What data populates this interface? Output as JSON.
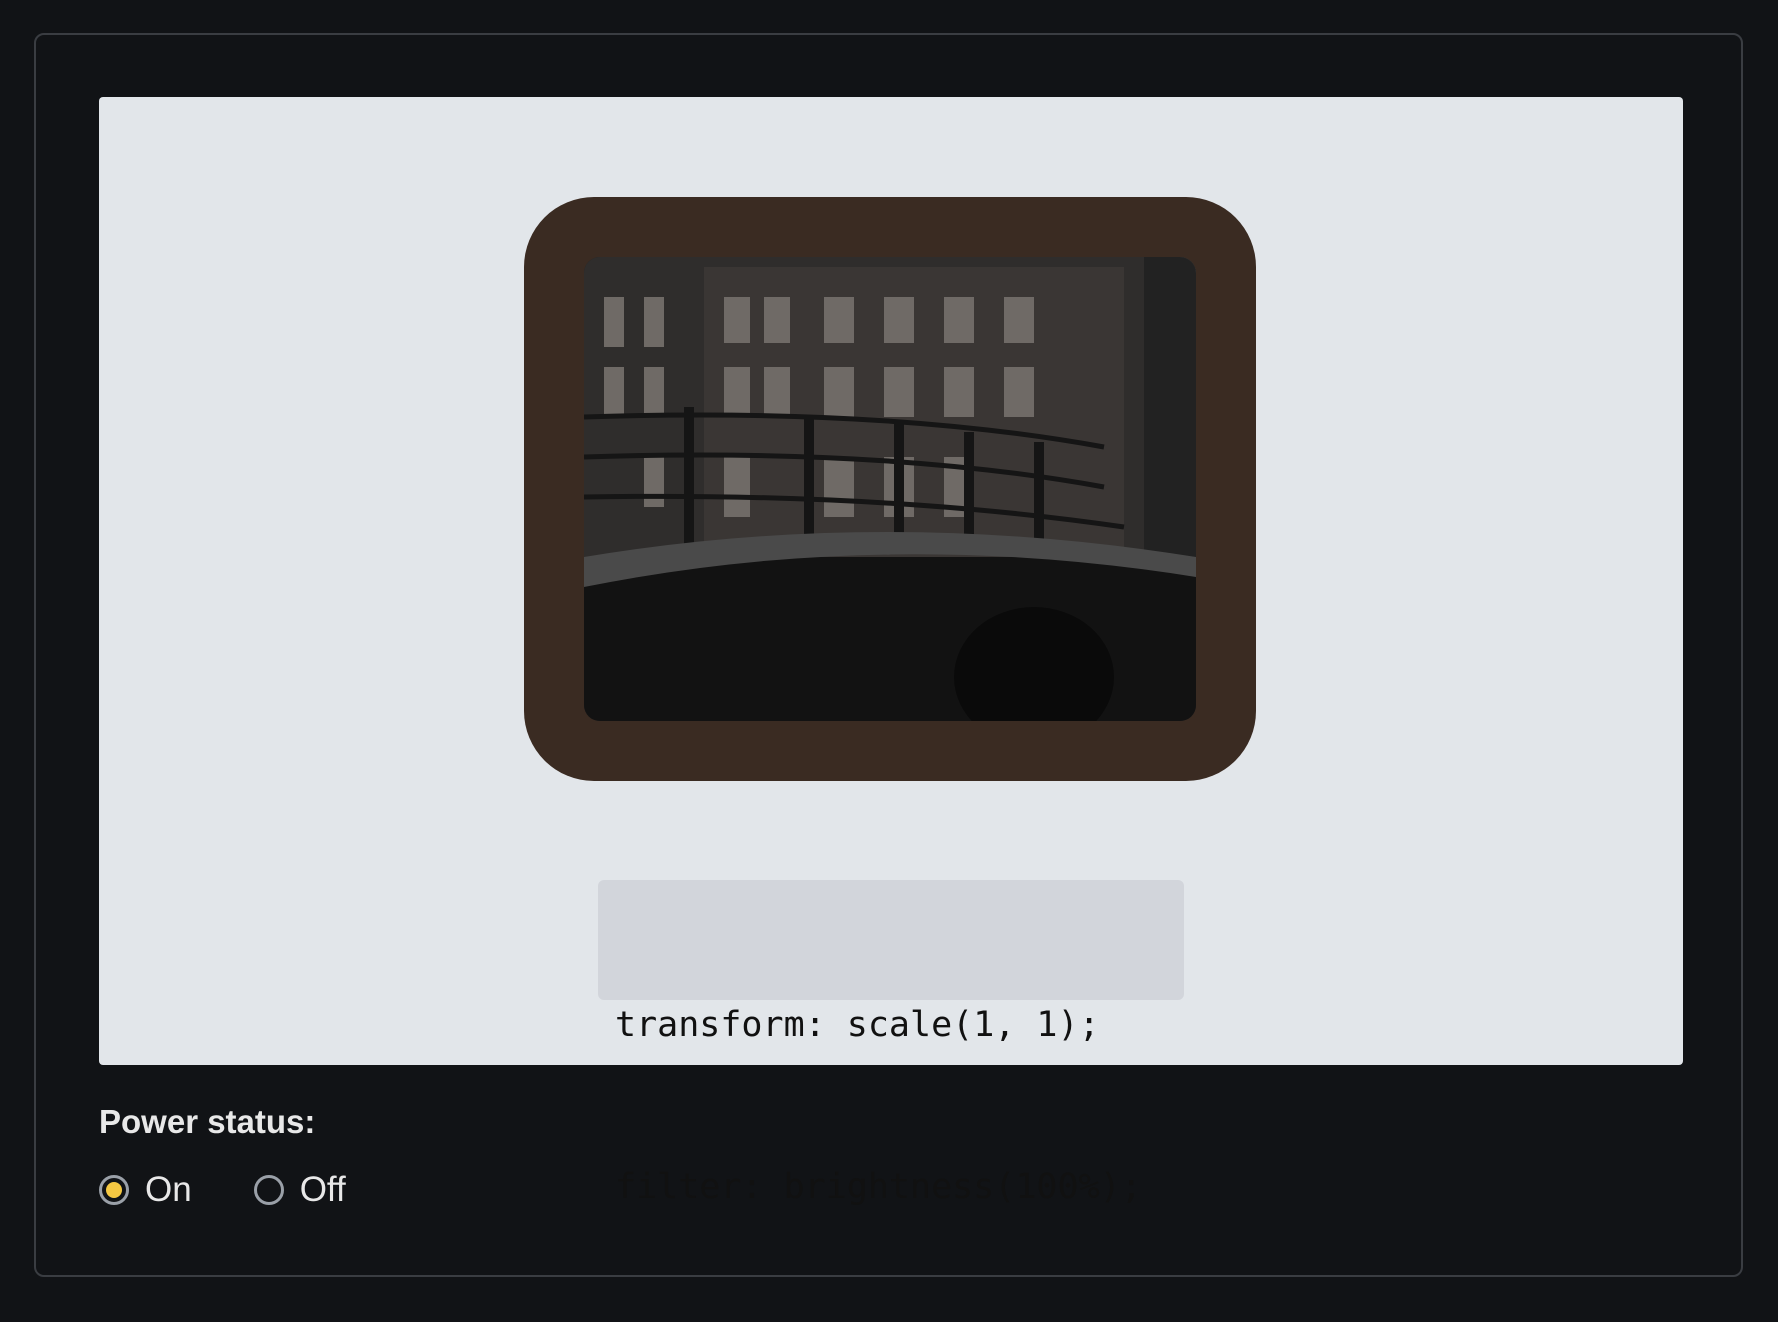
{
  "code": {
    "line1": "transform: scale(1, 1);",
    "line2": "filter: brightness(100%);"
  },
  "power": {
    "label": "Power status:",
    "options": [
      {
        "label": "On",
        "checked": true
      },
      {
        "label": "Off",
        "checked": false
      }
    ]
  },
  "colors": {
    "page_bg": "#111316",
    "stage_bg": "#e2e6ea",
    "tv_body": "#3a2b22",
    "code_bg": "#d2d5db",
    "radio_accent": "#f5c842"
  }
}
